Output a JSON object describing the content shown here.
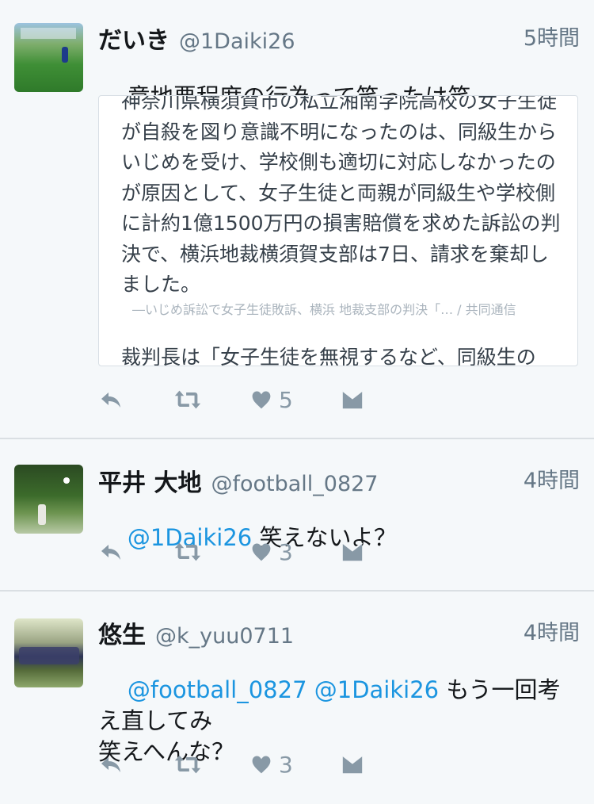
{
  "colors": {
    "background": "#f5f8fa",
    "mention": "#1b95e0",
    "secondary_text": "#657786",
    "action_icon": "#8899a6",
    "divider": "#dadfe3"
  },
  "tweets": [
    {
      "name": "だいき",
      "handle": "@1Daiki26",
      "time": "5時間",
      "text": "意地悪程度の行為って笑ったは笑",
      "quote": {
        "body": "神奈川県横須賀市の私立湘南学院高校の女子生徒が自殺を図り意識不明になったのは、同級生からいじめを受け、学校側も適切に対応しなかったのが原因として、女子生徒と両親が同級生や学校側に計約1億1500万円の損害賠償を求めた訴訟の判決で、横浜地裁横須賀支部は7日、請求を棄却しました。",
        "citation": "―いじめ訴訟で女子生徒敗訴、横浜 地裁支部の判決「… / 共同通信",
        "last_line": "裁判長は「女子生徒を無視するなど、同級生の"
      },
      "likes": "5",
      "icons": [
        "reply-icon",
        "retweet-icon",
        "like-icon",
        "message-icon"
      ]
    },
    {
      "name": "平井 大地",
      "handle": "@football_0827",
      "time": "4時間",
      "mentions": "@1Daiki26",
      "text": " 笑えないよ？",
      "likes": "3",
      "icons": [
        "reply-icon",
        "retweet-icon",
        "like-icon",
        "message-icon"
      ]
    },
    {
      "name": "悠生",
      "handle": "@k_yuu0711",
      "time": "4時間",
      "mentions": "@football_0827 @1Daiki26",
      "text": " もう一回考え直してみ\n笑えへんな？",
      "likes": "3",
      "icons": [
        "reply-icon",
        "retweet-icon",
        "like-icon",
        "message-icon"
      ]
    }
  ]
}
